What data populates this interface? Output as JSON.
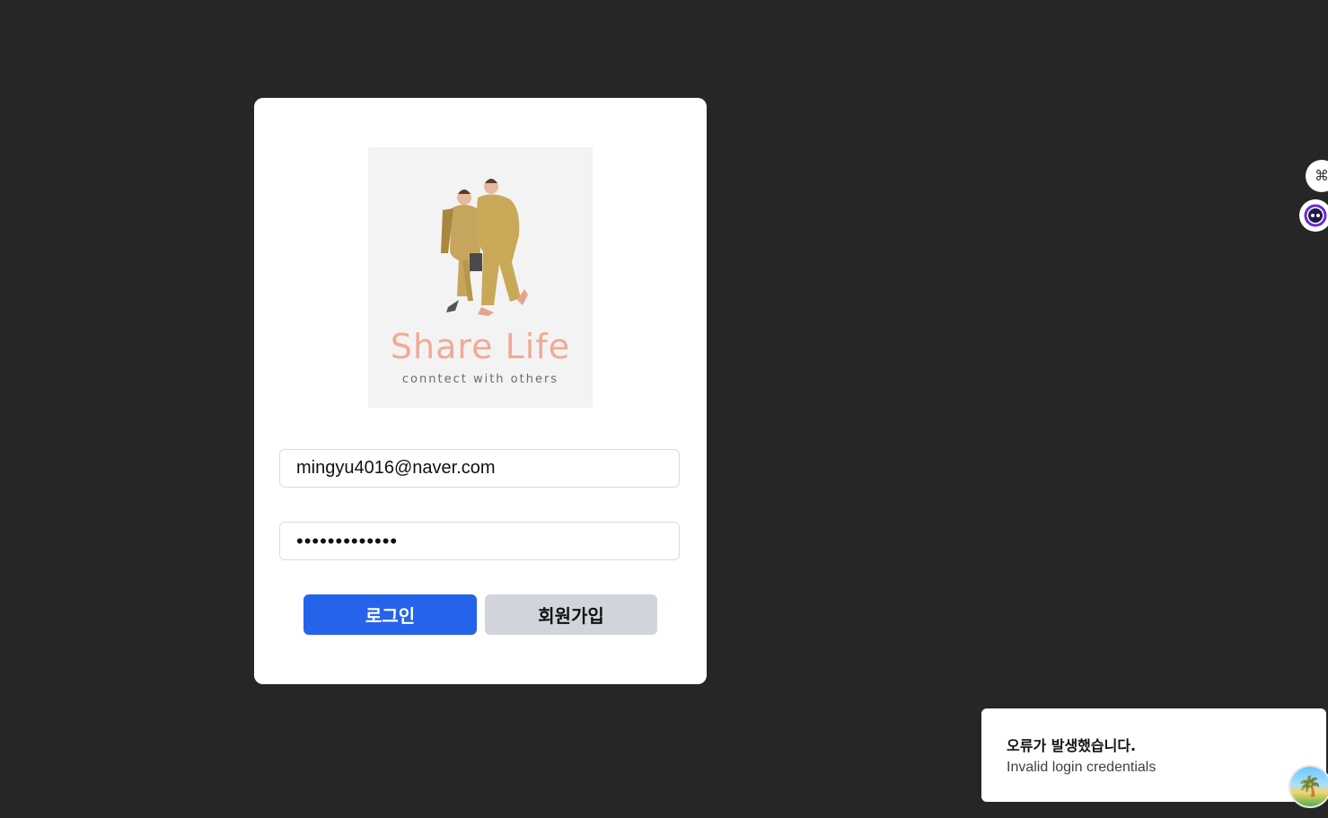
{
  "login_card": {
    "logo": {
      "brand": "Share Life",
      "tagline": "conntect with others",
      "illustration": "two-men-walking-in-coats"
    },
    "email_field": {
      "value": "mingyu4016@naver.com"
    },
    "password_field": {
      "value": "•••••••••••••"
    },
    "login_button": "로그인",
    "signup_button": "회원가입"
  },
  "side_widgets": {
    "command_icon": "⌘",
    "assistant_icon": "assistant-face-icon"
  },
  "toast": {
    "title": "오류가 발생했습니다.",
    "message": "Invalid login credentials"
  },
  "colors": {
    "background": "#262626",
    "primary_button": "#2563eb",
    "secondary_button": "#d1d5db",
    "brand_text": "#f0aa96"
  }
}
